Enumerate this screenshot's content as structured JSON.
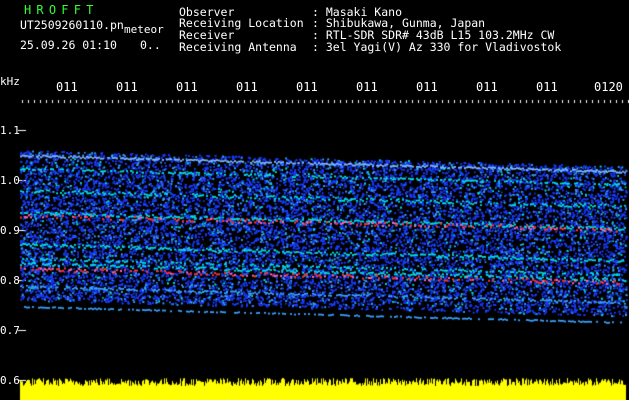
{
  "header": {
    "brand": "HROFFT",
    "filename": "UT2509260110.pn",
    "meteor_label": "meteor",
    "datetime": "25.09.26 01:10",
    "counter": "0..",
    "fields": [
      {
        "key": "Observer",
        "value": ": Masaki Kano"
      },
      {
        "key": "Receiving Location",
        "value": ": Shibukawa, Gunma, Japan"
      },
      {
        "key": "Receiver",
        "value": ": RTL-SDR SDR# 43dB L15 103.2MHz CW"
      },
      {
        "key": "Receiving Antenna",
        "value": ": 3el Yagi(V) Az 330 for Vladivostok"
      }
    ]
  },
  "spectrogram": {
    "y_unit": "kHz",
    "y_ticks": [
      "1.1",
      "1.0",
      "0.9",
      "0.8",
      "0.7",
      "0.6"
    ],
    "time_ticks": [
      "011",
      "011",
      "011",
      "011",
      "011",
      "011",
      "011",
      "011",
      "011",
      "0120"
    ],
    "colors": {
      "background": "#000000",
      "noise": "#1a3cff",
      "band": "#00e0e0",
      "hot": "#ff3030",
      "bottom_bar": "#ffff00",
      "label": "#33ff33"
    }
  }
}
